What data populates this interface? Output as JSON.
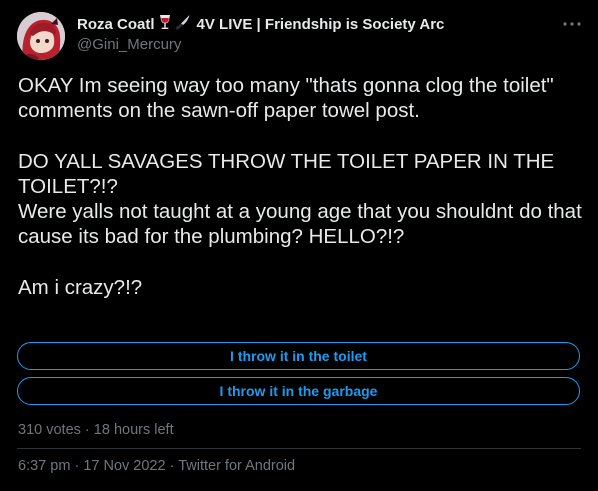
{
  "author": {
    "display_name": "Roza Coatl",
    "name_suffix": "4V LIVE | Friendship is Society Arc",
    "handle": "@Gini_Mercury",
    "name_emojis": [
      "wine-glass-icon",
      "knife-icon"
    ]
  },
  "tweet": {
    "text": "OKAY Im seeing way too many \"thats gonna clog the toilet\" comments on the sawn-off paper towel post.\n\nDO YALL SAVAGES THROW THE TOILET PAPER IN THE TOILET?!?\nWere yalls not taught at a young age that you shouldnt do that cause its bad for the plumbing? HELLO?!?\n\nAm i crazy?!?"
  },
  "poll": {
    "options": [
      {
        "label": "I throw it in the toilet"
      },
      {
        "label": "I throw it in the garbage"
      }
    ],
    "votes": "310 votes",
    "separator": "·",
    "time_left": "18 hours left"
  },
  "meta": {
    "time": "6:37 pm",
    "date": "17 Nov 2022",
    "separator": "·",
    "source": "Twitter for Android"
  },
  "colors": {
    "background": "#000000",
    "text": "#e7e9ea",
    "muted": "#71767b",
    "accent": "#1d9bf0",
    "divider": "#2f3336"
  }
}
